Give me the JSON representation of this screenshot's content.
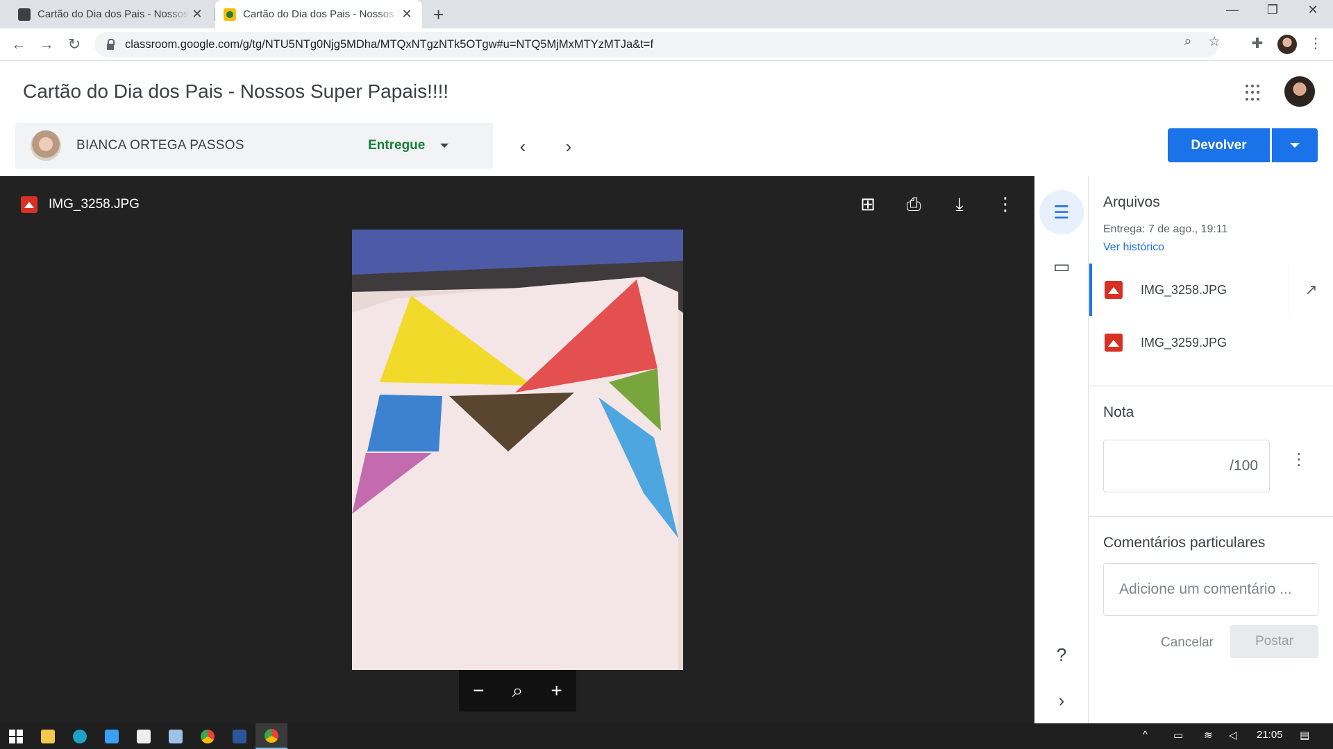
{
  "browser": {
    "tabs": [
      {
        "title": "Cartão do Dia dos Pais - Nossos Super Papais!!!!",
        "close": "✕"
      },
      {
        "title": "Cartão do Dia dos Pais - Nossos Super Papais!!!!",
        "close": "✕"
      }
    ],
    "url": "classroom.google.com/g/tg/NTU5NTg0Njg5MDha/MTQxNTgzNTk5OTgw#u=NTQ5MjMxMTYzMTJa&t=f"
  },
  "header": {
    "title": "Cartão do Dia dos Pais - Nossos Super Papais!!!!"
  },
  "student": {
    "name": "BIANCA ORTEGA PASSOS",
    "status": "Entregue"
  },
  "actions": {
    "return_label": "Devolver"
  },
  "viewer": {
    "filename": "IMG_3258.JPG"
  },
  "panel": {
    "files_heading": "Arquivos",
    "submitted": "Entrega: 7 de ago., 19:11",
    "history_link": "Ver histórico",
    "files": [
      {
        "name": "IMG_3258.JPG"
      },
      {
        "name": "IMG_3259.JPG"
      }
    ],
    "grade_heading": "Nota",
    "grade_max": "/100",
    "comments_heading": "Comentários particulares",
    "comment_placeholder": "Adicione um comentário ...",
    "cancel_label": "Cancelar",
    "post_label": "Postar"
  },
  "taskbar": {
    "time": "21:05"
  },
  "colors": {
    "accent": "#1a73e8",
    "status_green": "#188038",
    "file_icon_red": "#d93025",
    "viewer_bg": "#222222"
  },
  "icons": [
    "back-icon",
    "forward-icon",
    "reload-icon",
    "lock-icon",
    "zoom-icon",
    "star-icon",
    "extensions-icon",
    "apps-grid-icon",
    "chevron-left-icon",
    "chevron-right-icon",
    "add-comment-icon",
    "print-icon",
    "download-icon",
    "more-vert-icon",
    "zoom-out-icon",
    "zoom-reset-icon",
    "zoom-in-icon",
    "submission-details-icon",
    "comments-icon",
    "help-icon",
    "collapse-icon",
    "open-in-new-icon"
  ]
}
